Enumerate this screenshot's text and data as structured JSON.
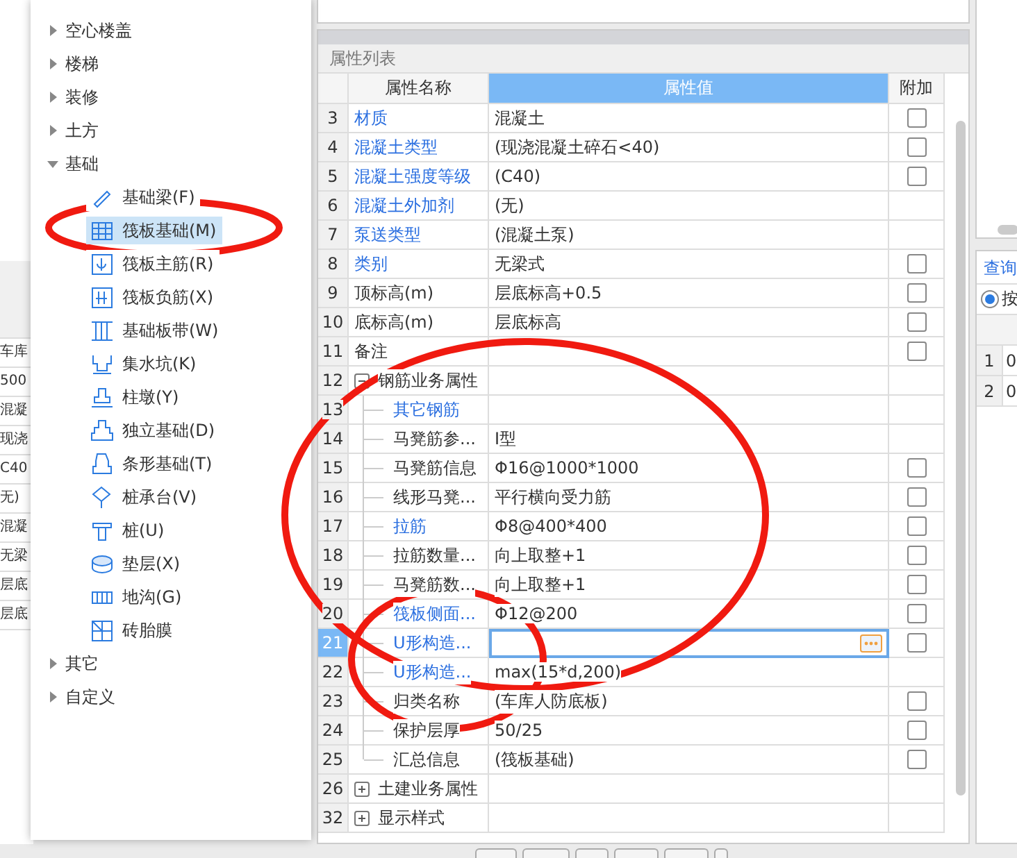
{
  "background_table": {
    "cells": [
      "车库",
      "500",
      "混凝",
      "现浇",
      "C40",
      "无)",
      "混凝",
      "无梁",
      "层底",
      "层底"
    ]
  },
  "tree": [
    {
      "label": "空心楼盖",
      "expanded": false
    },
    {
      "label": "楼梯",
      "expanded": false
    },
    {
      "label": "装修",
      "expanded": false
    },
    {
      "label": "土方",
      "expanded": false
    },
    {
      "label": "基础",
      "expanded": true,
      "children": [
        {
          "label": "基础梁(F)",
          "selected": false
        },
        {
          "label": "筏板基础(M)",
          "selected": true
        },
        {
          "label": "筏板主筋(R)",
          "selected": false
        },
        {
          "label": "筏板负筋(X)",
          "selected": false
        },
        {
          "label": "基础板带(W)",
          "selected": false
        },
        {
          "label": "集水坑(K)",
          "selected": false
        },
        {
          "label": "柱墩(Y)",
          "selected": false
        },
        {
          "label": "独立基础(D)",
          "selected": false
        },
        {
          "label": "条形基础(T)",
          "selected": false
        },
        {
          "label": "桩承台(V)",
          "selected": false
        },
        {
          "label": "桩(U)",
          "selected": false
        },
        {
          "label": "垫层(X)",
          "selected": false
        },
        {
          "label": "地沟(G)",
          "selected": false
        },
        {
          "label": "砖胎膜",
          "selected": false
        }
      ]
    },
    {
      "label": "其它",
      "expanded": false
    },
    {
      "label": "自定义",
      "expanded": false
    }
  ],
  "properties": {
    "title": "属性列表",
    "columns": [
      {
        "label": "属性名称",
        "selected": false
      },
      {
        "label": "属性值",
        "selected": true
      },
      {
        "label": "附加",
        "selected": false
      }
    ],
    "rows": [
      {
        "num": "3",
        "name": "材质",
        "value": "混凝土",
        "public": true,
        "extra": false,
        "selected": false
      },
      {
        "num": "4",
        "name": "混凝土类型",
        "value": "(现浇混凝土碎石<40)",
        "public": true,
        "extra": false,
        "selected": false
      },
      {
        "num": "5",
        "name": "混凝土强度等级",
        "value": "(C40)",
        "public": true,
        "extra": false,
        "selected": false
      },
      {
        "num": "6",
        "name": "混凝土外加剂",
        "value": "(无)",
        "public": true,
        "selected": false
      },
      {
        "num": "7",
        "name": "泵送类型",
        "value": "(混凝土泵)",
        "public": true,
        "selected": false
      },
      {
        "num": "8",
        "name": "类别",
        "value": "无梁式",
        "public": true,
        "extra": false,
        "selected": false
      },
      {
        "num": "9",
        "name": "顶标高(m)",
        "value": "层底标高+0.5",
        "public": false,
        "extra": false,
        "selected": false
      },
      {
        "num": "10",
        "name": "底标高(m)",
        "value": "层底标高",
        "public": false,
        "extra": false,
        "selected": false
      },
      {
        "num": "11",
        "name": "备注",
        "public": false,
        "extra": false,
        "selected": false
      },
      {
        "num": "12",
        "name": "钢筋业务属性",
        "kind": "group",
        "expanded": true,
        "selected": false,
        "children": [
          {
            "num": "13",
            "name": "其它钢筋",
            "public": true,
            "selected": false
          },
          {
            "num": "14",
            "name": "马凳筋参...",
            "value": "Ⅰ型",
            "public": false,
            "selected": false
          },
          {
            "num": "15",
            "name": "马凳筋信息",
            "value": "Φ16@1000*1000",
            "public": false,
            "extra": false,
            "selected": false
          },
          {
            "num": "16",
            "name": "线形马凳...",
            "value": "平行横向受力筋",
            "public": false,
            "extra": false,
            "selected": false
          },
          {
            "num": "17",
            "name": "拉筋",
            "value": "Φ8@400*400",
            "public": true,
            "extra": false,
            "selected": false
          },
          {
            "num": "18",
            "name": "拉筋数量...",
            "value": "向上取整+1",
            "public": false,
            "extra": false,
            "selected": false
          },
          {
            "num": "19",
            "name": "马凳筋数...",
            "value": "向上取整+1",
            "public": false,
            "extra": false,
            "selected": false
          },
          {
            "num": "20",
            "name": "筏板侧面...",
            "value": "Φ12@200",
            "public": true,
            "extra": false,
            "selected": false
          },
          {
            "num": "21",
            "name": "U形构造...",
            "public": true,
            "extra": false,
            "selected": true
          },
          {
            "num": "22",
            "name": "U形构造...",
            "value": "max(15*d,200)",
            "public": true,
            "selected": false
          },
          {
            "num": "23",
            "name": "归类名称",
            "value": "(车库人防底板)",
            "public": false,
            "extra": false,
            "selected": false
          },
          {
            "num": "24",
            "name": "保护层厚",
            "value": "50/25",
            "public": false,
            "extra": false,
            "selected": false
          },
          {
            "num": "25",
            "name": "汇总信息",
            "value": "(筏板基础)",
            "public": false,
            "extra": false,
            "selected": false
          }
        ]
      },
      {
        "num": "26",
        "name": "土建业务属性",
        "kind": "group",
        "expanded": false,
        "selected": false
      },
      {
        "num": "32",
        "name": "显示样式",
        "kind": "group",
        "expanded": false,
        "selected": false
      }
    ]
  },
  "query_panel": {
    "tab": "查询",
    "option": {
      "label": "按",
      "selected": true
    },
    "rows": [
      [
        "1",
        "0"
      ],
      [
        "2",
        "0"
      ]
    ]
  },
  "annotations": [
    {
      "kind": "ellipse"
    },
    {
      "kind": "ellipse"
    },
    {
      "kind": "ellipse"
    }
  ]
}
